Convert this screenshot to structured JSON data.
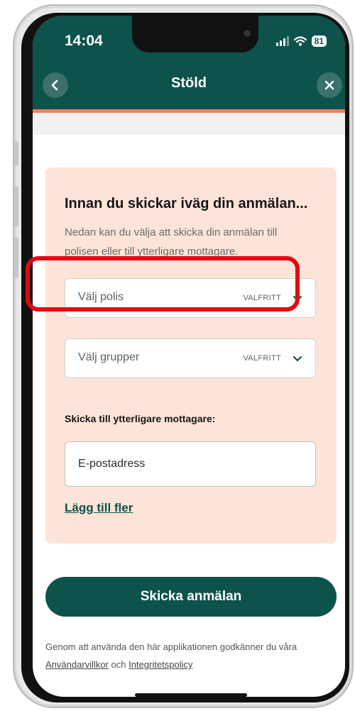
{
  "status": {
    "time": "14:04",
    "battery": "81"
  },
  "header": {
    "title": "Stöld",
    "back_icon": "chevron-left-icon",
    "close_icon": "close-icon"
  },
  "card": {
    "title": "Innan du skickar iväg din anmälan...",
    "description": "Nedan kan du välja att skicka din anmälan till polisen eller till ytterligare mottagare.",
    "police_select": {
      "label": "Välj polis",
      "optional": "VALFRITT"
    },
    "group_select": {
      "label": "Välj grupper",
      "optional": "VALFRITT"
    },
    "recipients_label": "Skicka till ytterligare mottagare:",
    "email_placeholder": "E-postadress",
    "add_more": "Lägg till fler"
  },
  "send_button": "Skicka anmälan",
  "footer": {
    "text": "Genom att använda den här applikationen godkänner du våra",
    "terms_link": "Användarvillkor",
    "and": "och",
    "privacy_link": "Integritetspolicy"
  },
  "colors": {
    "primary": "#0d524b",
    "accent": "#f0805f",
    "card_bg": "#fde4d8",
    "highlight": "#e30613"
  }
}
